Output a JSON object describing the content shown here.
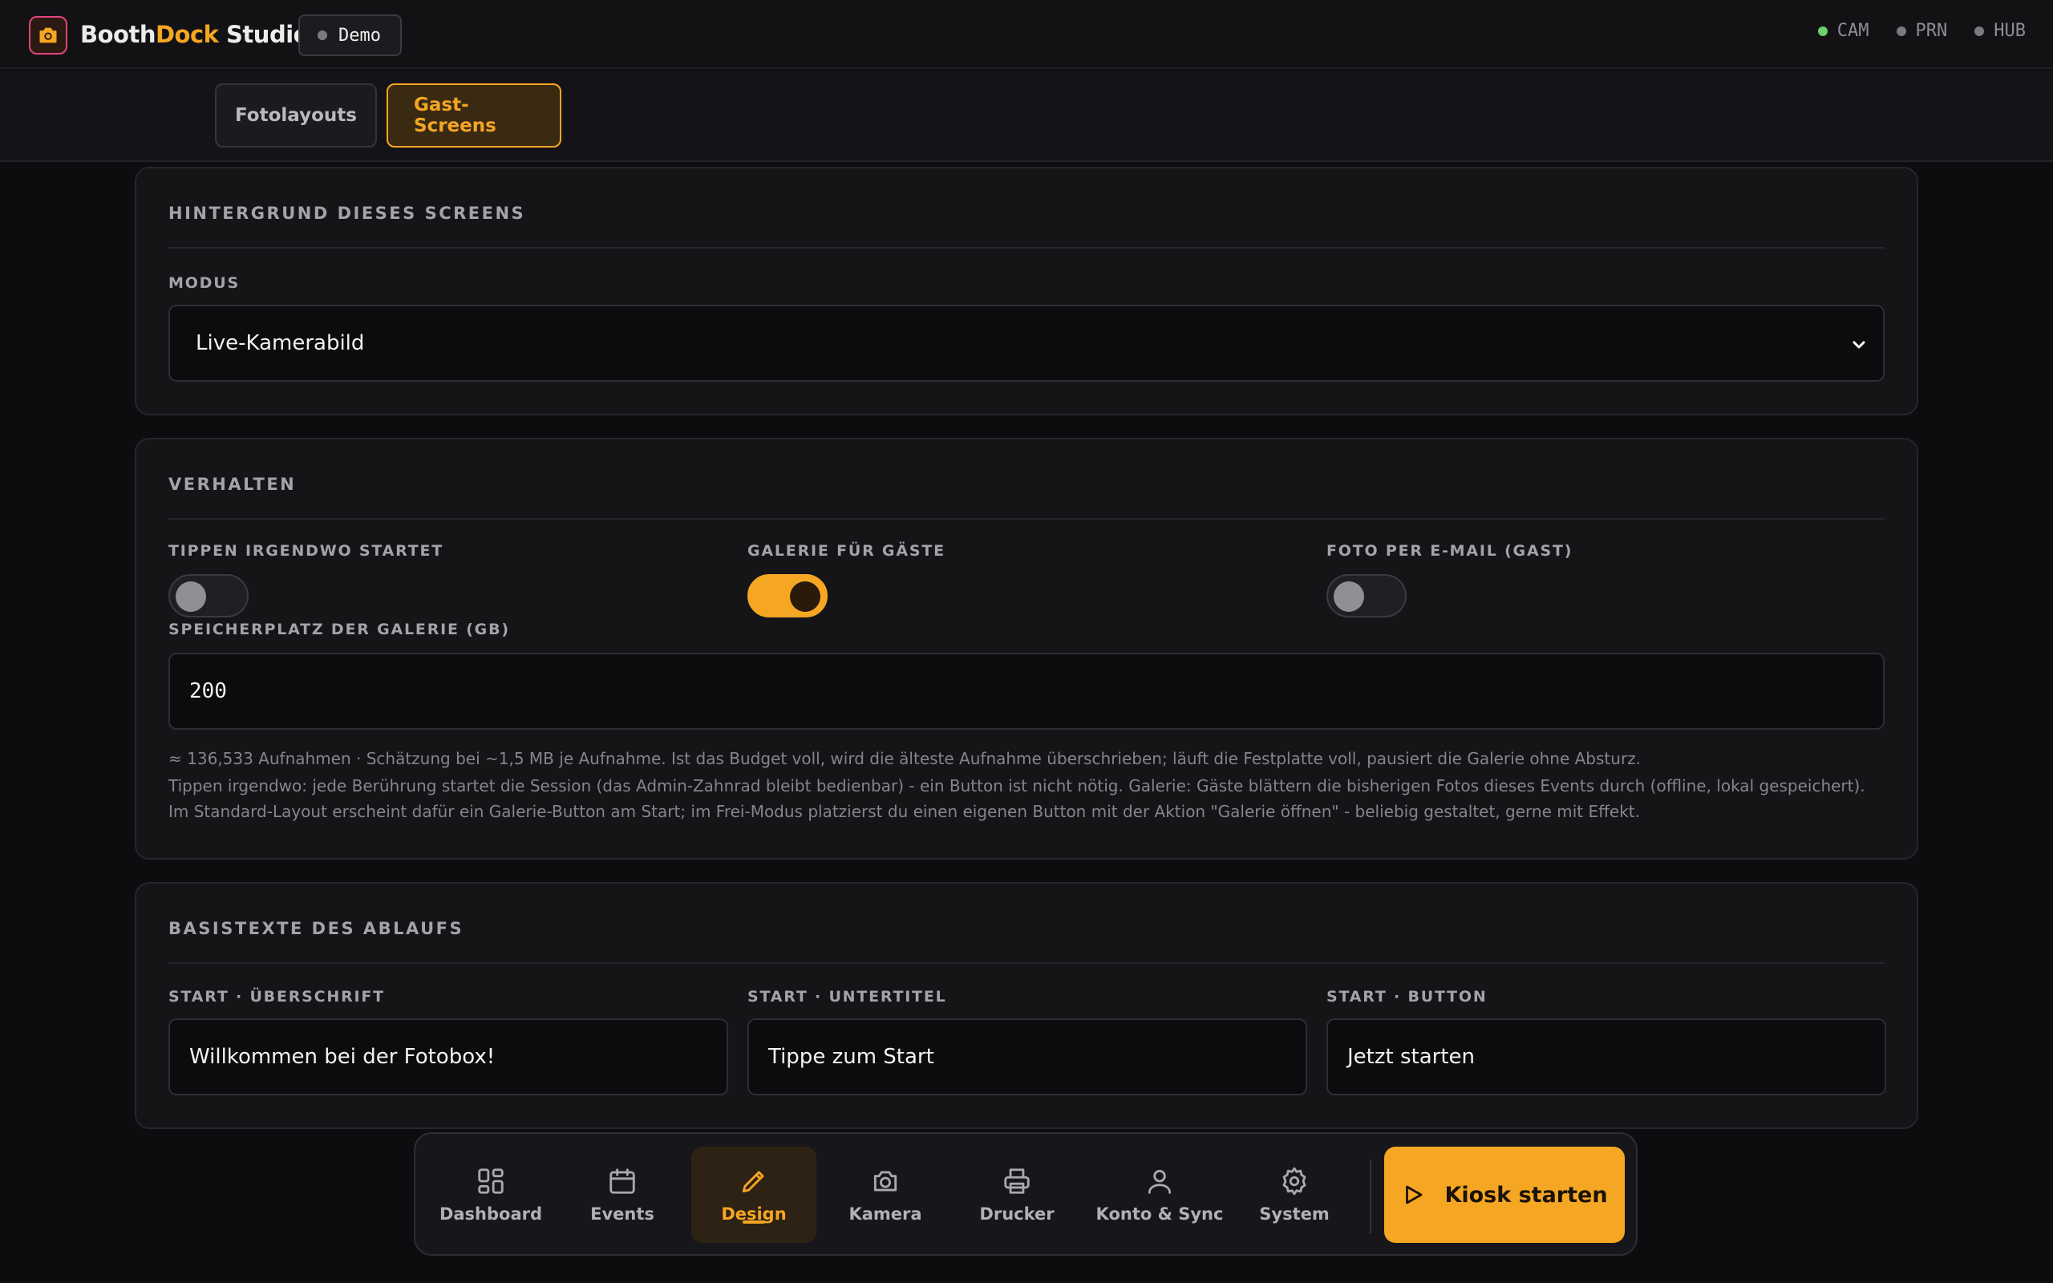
{
  "header": {
    "brand_part1": "Booth",
    "brand_part2": "Dock",
    "brand_part3": " Studio",
    "mode_badge": "Demo",
    "status": [
      {
        "label": "CAM",
        "state": "ok",
        "color": "#6fcf6a"
      },
      {
        "label": "PRN",
        "state": "off",
        "color": "#7a7a80"
      },
      {
        "label": "HUB",
        "state": "off",
        "color": "#7a7a80"
      }
    ]
  },
  "subtabs": [
    {
      "label": "Fotolayouts",
      "active": false
    },
    {
      "label": "Gast-Screens",
      "active": true
    }
  ],
  "background_card": {
    "title": "HINTERGRUND DIESES SCREENS",
    "mode_label": "MODUS",
    "mode_value": "Live-Kamerabild"
  },
  "behavior_card": {
    "title": "VERHALTEN",
    "toggles": [
      {
        "label": "TIPPEN IRGENDWO STARTET",
        "on": false
      },
      {
        "label": "GALERIE FÜR GÄSTE",
        "on": true
      },
      {
        "label": "FOTO PER E-MAIL (GAST)",
        "on": false
      }
    ],
    "storage_label": "SPEICHERPLATZ DER GALERIE (GB)",
    "storage_value": "200",
    "hint_line1": "≈ 136,533 Aufnahmen · Schätzung bei ~1,5 MB je Aufnahme. Ist das Budget voll, wird die älteste Aufnahme überschrieben; läuft die Festplatte voll, pausiert die Galerie ohne Absturz.",
    "hint_line2": "Tippen irgendwo: jede Berührung startet die Session (das Admin-Zahnrad bleibt bedienbar) - ein Button ist nicht nötig. Galerie: Gäste blättern die bisherigen Fotos dieses Events durch (offline, lokal gespeichert). Im Standard-Layout erscheint dafür ein Galerie-Button am Start; im Frei-Modus platzierst du einen eigenen Button mit der Aktion \"Galerie öffnen\" - beliebig gestaltet, gerne mit Effekt."
  },
  "texts_card": {
    "title": "BASISTEXTE DES ABLAUFS",
    "fields": [
      {
        "label": "START · ÜBERSCHRIFT",
        "value": "Willkommen bei der Fotobox!"
      },
      {
        "label": "START · UNTERTITEL",
        "value": "Tippe zum Start"
      },
      {
        "label": "START · BUTTON",
        "value": "Jetzt starten"
      }
    ]
  },
  "bottom_nav": {
    "items": [
      {
        "label": "Dashboard",
        "icon": "dashboard-grid-icon",
        "active": false
      },
      {
        "label": "Events",
        "icon": "calendar-icon",
        "active": false
      },
      {
        "label": "Design",
        "icon": "pencil-icon",
        "active": true
      },
      {
        "label": "Kamera",
        "icon": "camera-icon",
        "active": false
      },
      {
        "label": "Drucker",
        "icon": "printer-icon",
        "active": false
      },
      {
        "label": "Konto & Sync",
        "icon": "user-icon",
        "active": false
      },
      {
        "label": "System",
        "icon": "gear-icon",
        "active": false
      }
    ],
    "kiosk_label": "Kiosk starten",
    "kiosk_icon": "play-icon"
  },
  "colors": {
    "accent": "#f5a623",
    "background": "#0d0d10",
    "card": "#151518"
  }
}
